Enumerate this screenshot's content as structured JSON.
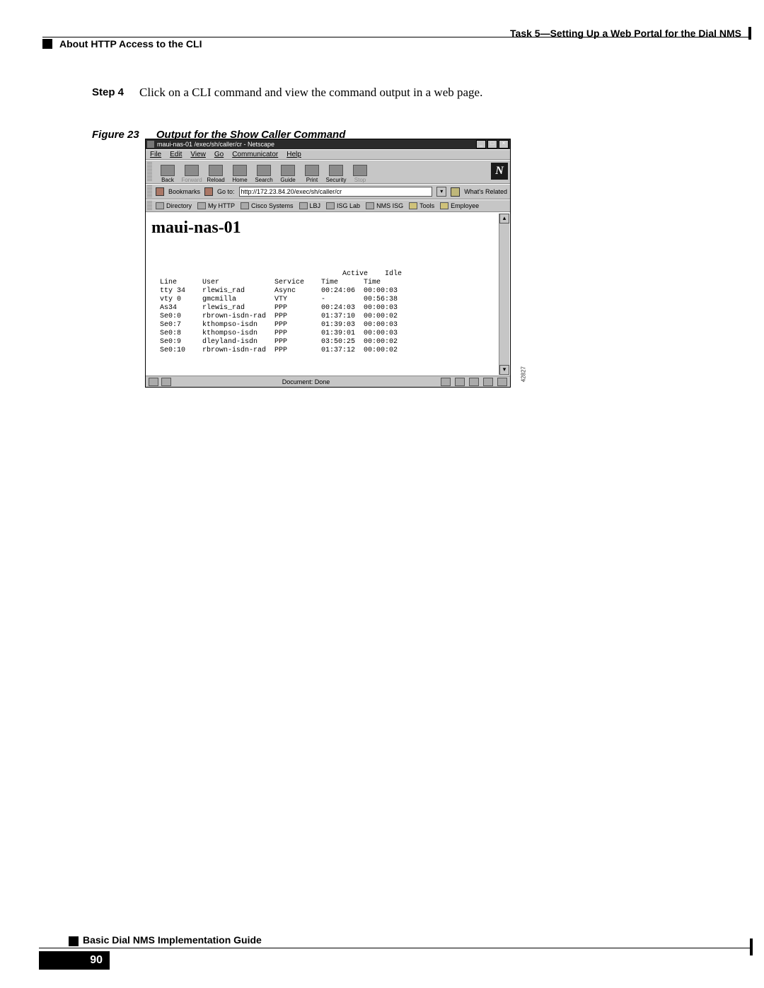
{
  "header": {
    "right": "Task 5—Setting Up a Web Portal for the Dial NMS",
    "left": "About HTTP Access to the CLI"
  },
  "step": {
    "label": "Step 4",
    "text": "Click on a CLI command and view the command output in a web page."
  },
  "figure": {
    "label": "Figure 23",
    "caption": "Output for the Show Caller Command",
    "ref": "42827"
  },
  "browser": {
    "title": "maui-nas-01 /exec/sh/caller/cr - Netscape",
    "menus": [
      "File",
      "Edit",
      "View",
      "Go",
      "Communicator",
      "Help"
    ],
    "toolbar": [
      "Back",
      "Forward",
      "Reload",
      "Home",
      "Search",
      "Guide",
      "Print",
      "Security",
      "Stop"
    ],
    "logo": "N",
    "location": {
      "bookmarks": "Bookmarks",
      "goto_label": "Go to:",
      "url": "http://172.23.84.20/exec/sh/caller/cr",
      "whats_related": "What's Related"
    },
    "personal_toolbar": [
      "Directory",
      "My HTTP",
      "Cisco Systems",
      "LBJ",
      "ISG Lab",
      "NMS ISG",
      "Tools",
      "Employee"
    ],
    "status": "Document: Done"
  },
  "page_content": {
    "heading": "maui-nas-01",
    "columns_l1": "                                             Active    Idle",
    "columns_l2": "  Line      User             Service    Time      Time",
    "rows": [
      "  tty 34    rlewis_rad       Async      00:24:06  00:00:03",
      "  vty 0     gmcmilla         VTY        -         00:56:38",
      "  As34      rlewis_rad       PPP        00:24:03  00:00:03",
      "  Se0:0     rbrown-isdn-rad  PPP        01:37:10  00:00:02",
      "  Se0:7     kthompso-isdn    PPP        01:39:03  00:00:03",
      "  Se0:8     kthompso-isdn    PPP        01:39:01  00:00:03",
      "  Se0:9     dleyland-isdn    PPP        03:50:25  00:00:02",
      "  Se0:10    rbrown-isdn-rad  PPP        01:37:12  00:00:02"
    ]
  },
  "footer": {
    "title": "Basic Dial NMS Implementation Guide",
    "page": "90"
  }
}
